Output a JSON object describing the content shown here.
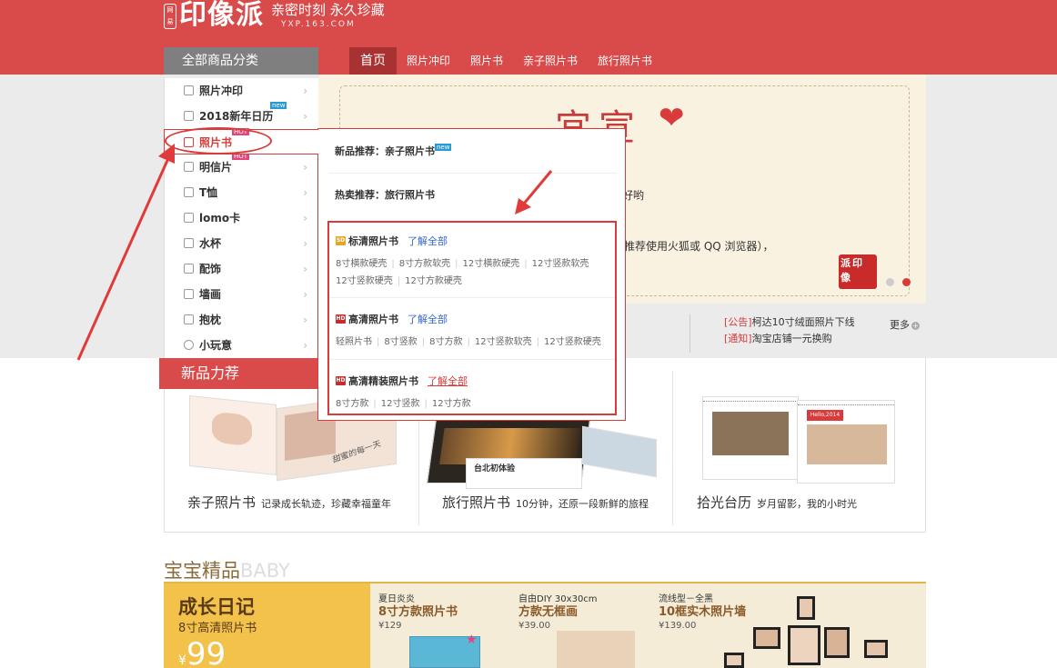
{
  "header": {
    "logo_mark": "网易",
    "logo_text": "印像派",
    "slogan": "亲密时刻 永久珍藏",
    "domain": "YXP.163.COM"
  },
  "category_head": "全部商品分类",
  "nav": [
    "首页",
    "照片冲印",
    "照片书",
    "亲子照片书",
    "旅行照片书"
  ],
  "sidebar": [
    {
      "label": "照片冲印",
      "badge": ""
    },
    {
      "label": "2018新年日历",
      "badge": "new"
    },
    {
      "label": "照片书",
      "badge": "HOT"
    },
    {
      "label": "明信片",
      "badge": "HOT"
    },
    {
      "label": "T恤",
      "badge": ""
    },
    {
      "label": "lomo卡",
      "badge": ""
    },
    {
      "label": "水杯",
      "badge": ""
    },
    {
      "label": "配饰",
      "badge": ""
    },
    {
      "label": "墙画",
      "badge": ""
    },
    {
      "label": "抱枕",
      "badge": ""
    },
    {
      "label": "小玩意",
      "badge": ""
    }
  ],
  "popup": {
    "rec_new": "新品推荐：亲子照片书",
    "rec_new_badge": "new",
    "rec_hot": "热卖推荐：旅行照片书",
    "groups": [
      {
        "icon": "SD",
        "title": "标清照片书",
        "more": "了解全部",
        "links": [
          "8寸横款硬壳",
          "8寸方款软壳",
          "12寸横款硬壳",
          "12寸竖款软壳",
          "12寸竖款硬壳",
          "12寸方款硬壳"
        ]
      },
      {
        "icon": "HD",
        "title": "高清照片书",
        "more": "了解全部",
        "links": [
          "轻照片书",
          "8寸竖款",
          "8寸方款",
          "12寸竖款软壳",
          "12寸竖款硬壳"
        ]
      },
      {
        "icon": "HD",
        "title": "高清精装照片书",
        "more": "了解全部",
        "links": [
          "8寸方款",
          "12寸竖款",
          "12寸方款"
        ]
      }
    ]
  },
  "banner": {
    "title": "宜宣",
    "line1": "好哟",
    "line2": "推荐使用火狐或 QQ 浏览器），",
    "seal": "派印 像"
  },
  "notices": {
    "items": [
      {
        "tag": "[公告]",
        "text": "柯达10寸绒面照片下线"
      },
      {
        "tag": "[通知]",
        "text": "淘宝店铺一元换购"
      }
    ],
    "more": "更多"
  },
  "new_products": {
    "head": "新品力荐",
    "items": [
      {
        "name": "亲子照片书",
        "desc": "记录成长轨迹，珍藏幸福童年",
        "book_caption": "甜蜜的每一天"
      },
      {
        "name": "旅行照片书",
        "desc": "10分钟，还原一段新鲜的旅程",
        "book_caption": "台北初体验"
      },
      {
        "name": "拾光台历",
        "desc": "岁月留影，我的小时光",
        "book_caption": "Hello,2014"
      }
    ]
  },
  "baby": {
    "title": "宝宝精品",
    "title_en": "BABY",
    "main": {
      "name": "成长日记",
      "sub": "8寸高清照片书",
      "price_symbol": "¥",
      "price": "99"
    },
    "cards": [
      {
        "sub": "夏日炎炎",
        "name": "8寸方款照片书",
        "price": "¥129"
      },
      {
        "sub": "自由DIY 30x30cm",
        "name": "方款无框画",
        "price": "¥39.00"
      },
      {
        "sub": "流线型－全黑",
        "name": "10框实木照片墙",
        "price": "¥139.00"
      }
    ]
  },
  "colors": {
    "brand_red": "#d94b4b",
    "nav_active": "#a83232",
    "link_blue": "#3366cc",
    "gold": "#f3c24a"
  }
}
